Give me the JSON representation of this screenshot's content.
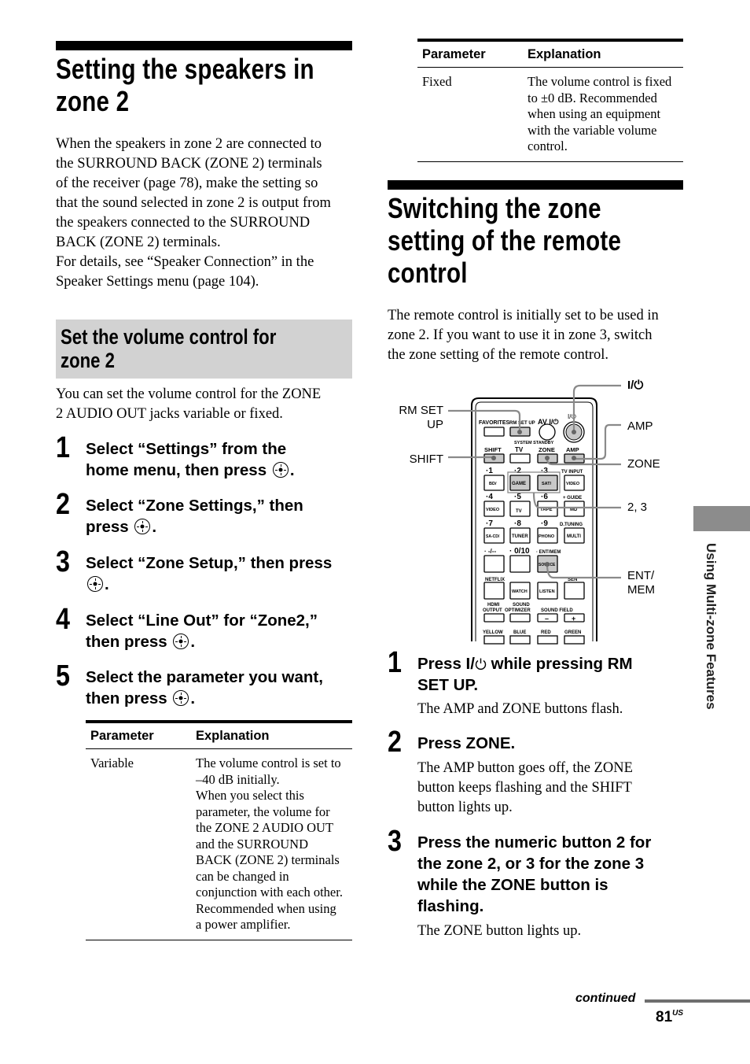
{
  "left": {
    "title_line1": "Setting the speakers in",
    "title_line2": "zone 2",
    "intro": [
      "When the speakers in zone 2 are connected to",
      "the SURROUND BACK (ZONE 2) terminals",
      "of the receiver (page 78), make the setting so",
      "that the sound selected in zone 2 is output from",
      "the speakers connected to the SURROUND",
      "BACK (ZONE 2) terminals.",
      "For details, see “Speaker Connection” in the",
      "Speaker Settings menu (page 104)."
    ],
    "subsection_title_line1": "Set the volume control for",
    "subsection_title_line2": "zone 2",
    "subsection_intro": [
      "You can set the volume control for the ZONE",
      "2 AUDIO OUT jacks variable or fixed."
    ],
    "steps": [
      {
        "num": "1",
        "line1": "Select “Settings” from the",
        "line2": "home menu, then press",
        "end": "."
      },
      {
        "num": "2",
        "line1": "Select “Zone Settings,” then",
        "line2": "press",
        "end": "."
      },
      {
        "num": "3",
        "line1": "Select “Zone Setup,” then press",
        "line2": "",
        "end": "."
      },
      {
        "num": "4",
        "line1": "Select “Line Out” for “Zone2,”",
        "line2": "then press",
        "end": "."
      },
      {
        "num": "5",
        "line1": "Select the parameter you want,",
        "line2": "then press",
        "end": "."
      }
    ],
    "table": {
      "headers": [
        "Parameter",
        "Explanation"
      ],
      "rows": [
        {
          "param": "Variable",
          "explanation_lines": [
            "The volume control is set to",
            "–40 dB initially.",
            "When you select this",
            "parameter, the volume for",
            "the ZONE 2 AUDIO OUT",
            "and the SURROUND",
            "BACK (ZONE 2) terminals",
            "can be changed in",
            "conjunction with each other.",
            "Recommended when using",
            "a power amplifier."
          ]
        }
      ]
    }
  },
  "right": {
    "table": {
      "headers": [
        "Parameter",
        "Explanation"
      ],
      "rows": [
        {
          "param": "Fixed",
          "explanation_lines": [
            "The volume control is fixed",
            "to ±0 dB. Recommended",
            "when using an equipment",
            "with the variable volume",
            "control."
          ]
        }
      ]
    },
    "title_lines": [
      "Switching the zone",
      "setting of the remote",
      "control"
    ],
    "intro": [
      "The remote control is initially set to be used in",
      "zone 2. If you want to use it in zone 3, switch",
      "the zone setting of the remote control."
    ],
    "remote": {
      "callouts_left": [
        "RM SET",
        "UP",
        "SHIFT"
      ],
      "callouts_right": [
        "I/⏻",
        "AMP",
        "ZONE",
        "2, 3",
        "ENT/",
        "MEM"
      ],
      "labels": {
        "favorites": "FAVORITES",
        "rm_set_up": "RM SET UP",
        "av": "AV I/⏻",
        "power": "I/⏻",
        "system_standby": "SYSTEM STANDBY",
        "shift": "SHIFT",
        "tv": "TV",
        "zone": "ZONE",
        "amp": "AMP",
        "n1": "1",
        "n2": "2",
        "n3": "3",
        "tv_input": "TV INPUT",
        "bd_dvd": "BD/ DVD",
        "game": "GAME",
        "sat_catv": "SAT/ CATV",
        "video1": "VIDEO 1",
        "n4": "4",
        "n5": "5",
        "n6": "6",
        "guide": "GUIDE",
        "video2": "VIDEO 2",
        "tv2": "TV",
        "tape": "TAPE",
        "md": "MD",
        "n7": "7",
        "n8": "8",
        "n9": "9",
        "d_tuning": "D.TUNING",
        "sacd": "SA-CD/ CD",
        "tuner": "TUNER",
        "phono": "PHONO",
        "multi_in": "MULTI IN",
        "dash": "-/--",
        "n010": "0/10",
        "ent_mem": "ENT/MEM",
        "source": "SOURCE",
        "netflix": "NETFLIX",
        "sen": "SEN",
        "watch": "WATCH",
        "listen": "LISTEN",
        "hdmi_output": "HDMI OUTPUT",
        "sound_optimizer": "SOUND OPTIMIZER",
        "sound_field": "SOUND FIELD",
        "minus": "–",
        "plus": "+",
        "yellow": "YELLOW",
        "blue": "BLUE",
        "red": "RED",
        "green": "GREEN"
      }
    },
    "steps": [
      {
        "num": "1",
        "line1_pre": "Press I/",
        "line1_post": " while pressing RM",
        "line2": "SET UP.",
        "note": "The AMP and ZONE buttons flash."
      },
      {
        "num": "2",
        "line1": "Press ZONE.",
        "note_lines": [
          "The AMP button goes off, the ZONE",
          "button keeps flashing and the SHIFT",
          "button lights up."
        ]
      },
      {
        "num": "3",
        "lines": [
          "Press the numeric button 2 for",
          "the zone 2, or 3 for the zone 3",
          "while the ZONE button is",
          "flashing."
        ],
        "note": "The ZONE button lights up."
      }
    ]
  },
  "side_tab": {
    "label": "Using Multi-zone Features"
  },
  "footer": {
    "continued": "continued",
    "page": "81",
    "page_suffix": "US"
  }
}
